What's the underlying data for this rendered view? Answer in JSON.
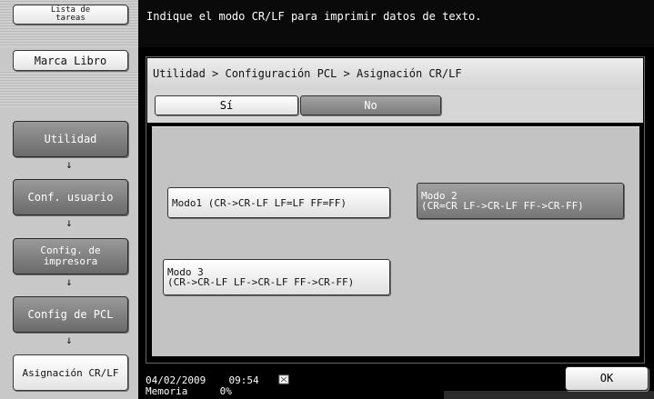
{
  "sidebar": {
    "job_list_label": "Lista de\ntareas",
    "bookmark_label": "Marca Libro",
    "arrow_glyph": "↓",
    "steps": [
      {
        "label": "Utilidad"
      },
      {
        "label": "Conf. usuario"
      },
      {
        "label": "Config. de\nimpresora"
      },
      {
        "label": "Config de PCL"
      },
      {
        "label": "Asignación CR/LF"
      }
    ]
  },
  "header": {
    "message": "Indique el modo CR/LF para imprimir datos de texto."
  },
  "main": {
    "breadcrumb": "Utilidad > Configuración PCL > Asignación CR/LF",
    "tabs": [
      {
        "label": "Sí",
        "selected": false
      },
      {
        "label": "No",
        "selected": true
      }
    ],
    "modes": [
      {
        "line1": "Modo1 (CR->CR-LF LF=LF FF=FF)",
        "line2": "",
        "selected": false
      },
      {
        "line1": "Modo 2",
        "line2": "(CR=CR LF->CR-LF FF->CR-FF)",
        "selected": true
      },
      {
        "line1": "Modo 3",
        "line2": "(CR->CR-LF LF->CR-LF FF->CR-FF)",
        "selected": false
      }
    ]
  },
  "status": {
    "date": "04/02/2009",
    "time": "09:54",
    "memory_label": "Memoria",
    "memory_value": "0%",
    "icon": "memory-chip-icon"
  },
  "footer": {
    "ok_label": "OK"
  },
  "colors": {
    "selected_button": "#808080",
    "panel_background": "#c3c3c3",
    "screen_background": "#000000"
  }
}
